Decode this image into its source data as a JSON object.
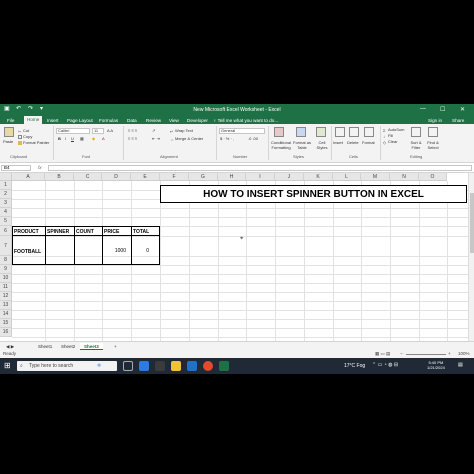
{
  "window": {
    "title": "New Microsoft Excel Worksheet - Excel",
    "min": "—",
    "max": "☐",
    "close": "✕"
  },
  "quick_access": {
    "save": "▣",
    "undo": "↶",
    "redo": "↷",
    "more": "▾"
  },
  "ribbon_tabs": [
    "File",
    "Home",
    "Insert",
    "Page Layout",
    "Formulas",
    "Data",
    "Review",
    "View",
    "Developer"
  ],
  "active_tab": "Home",
  "tell_me": "♀ Tell me what you want to do...",
  "sign_in": "Sign in",
  "share": "Share",
  "ribbon": {
    "clipboard": {
      "paste": "Paste",
      "cut": "Cut",
      "copy": "Copy",
      "format_painter": "Format Painter",
      "label": "Clipboard"
    },
    "font": {
      "name": "Calibri",
      "size": "11",
      "bold": "B",
      "italic": "I",
      "underline": "U",
      "label": "Font"
    },
    "alignment": {
      "wrap_text": "Wrap Text",
      "merge_center": "Merge & Center",
      "label": "Alignment"
    },
    "number": {
      "format": "General",
      "label": "Number"
    },
    "styles": {
      "conditional": "Conditional Formatting",
      "format_table": "Format as Table",
      "cell_styles": "Cell Styles",
      "label": "Styles"
    },
    "cells": {
      "insert": "Insert",
      "delete": "Delete",
      "format": "Format",
      "label": "Cells"
    },
    "editing": {
      "autosum": "AutoSum",
      "fill": "Fill",
      "clear": "Clear",
      "sort_filter": "Sort & Filter",
      "find_select": "Find & Select",
      "label": "Editing"
    }
  },
  "formula_bar": {
    "name_box": "B4",
    "fx": "fx",
    "value": ""
  },
  "columns": [
    "A",
    "B",
    "C",
    "D",
    "E",
    "F",
    "G",
    "H",
    "I",
    "J",
    "K",
    "L",
    "M",
    "N",
    "O"
  ],
  "rows": [
    "1",
    "2",
    "3",
    "4",
    "5",
    "6",
    "7",
    "8",
    "9",
    "10",
    "11",
    "12",
    "13",
    "14",
    "15",
    "16"
  ],
  "sheet_title": "HOW TO INSERT SPINNER BUTTON IN EXCEL",
  "table": {
    "headers": [
      "PRODUCT",
      "SPINNER",
      "COUNT",
      "PRICE",
      "TOTAL"
    ],
    "row": {
      "product": "FOOTBALL",
      "price": "1000",
      "total": "0"
    }
  },
  "sheets": [
    "Sheet1",
    "Sheet2",
    "Sheet3"
  ],
  "active_sheet": "Sheet3",
  "add_sheet": "+",
  "status": {
    "ready": "Ready",
    "zoom": "100%",
    "zoom_minus": "−",
    "zoom_plus": "+"
  },
  "taskbar": {
    "search_placeholder": "Type here to search",
    "weather": "17°C Fog",
    "time": "5:40 PM",
    "date": "1/21/2024"
  },
  "colors": {
    "excel_green": "#1e7145",
    "taskbar": "#202a36"
  }
}
